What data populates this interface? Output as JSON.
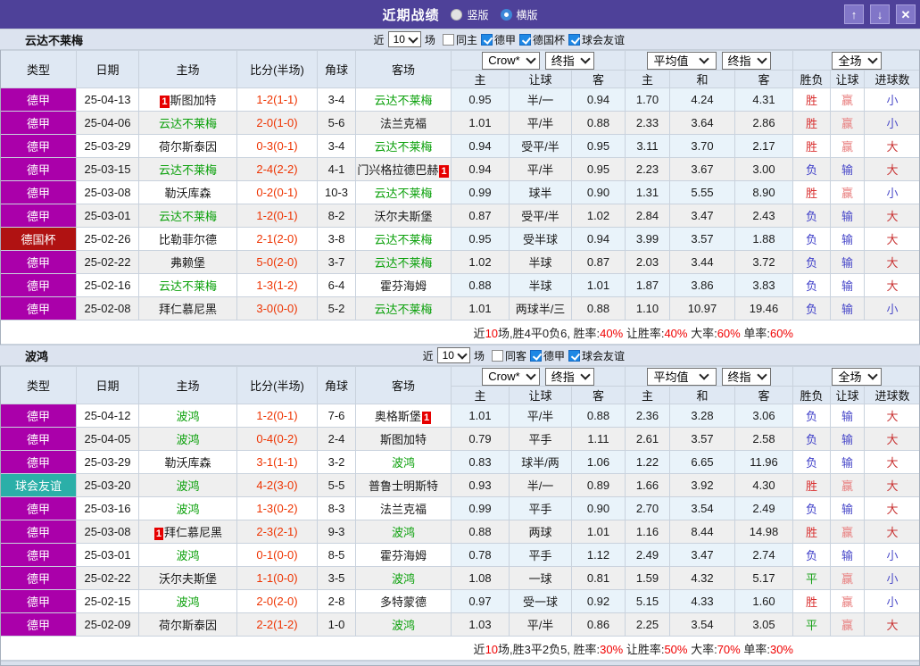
{
  "titlebar": {
    "title": "近期战绩",
    "radios": [
      {
        "label": "竖版",
        "selected": false
      },
      {
        "label": "横版",
        "selected": true
      }
    ],
    "buttons": {
      "up": "↑",
      "down": "↓",
      "close": "✕"
    }
  },
  "filters_common": {
    "near_label": "近",
    "near_value": "10",
    "games_label": "场"
  },
  "table_header": {
    "selects": {
      "crow": "Crow*",
      "crow_final": "终指",
      "avg": "平均值",
      "avg_final": "终指",
      "scope": "全场"
    },
    "columns": [
      "类型",
      "日期",
      "主场",
      "比分(半场)",
      "角球",
      "客场"
    ],
    "subcolumns": [
      "主",
      "让球",
      "客",
      "主",
      "和",
      "客",
      "胜负",
      "让球",
      "进球数"
    ]
  },
  "type_colors": {
    "德甲": "#aa00aa",
    "德国杯": "#b01212",
    "球会友谊": "#2bafa8"
  },
  "result_colors": {
    "胜": "#d93030",
    "负": "#3c3cc8",
    "平": "#18a018",
    "赢": "#e87d7d",
    "输": "#4646c8",
    "大": "#c83232",
    "小": "#4a4ac8"
  },
  "sections": [
    {
      "team": "云达不莱梅",
      "filters": [
        {
          "label": "同主",
          "checked": false
        },
        {
          "label": "德甲",
          "checked": true
        },
        {
          "label": "德国杯",
          "checked": true
        },
        {
          "label": "球会友谊",
          "checked": true
        }
      ],
      "rows": [
        {
          "type": "德甲",
          "date": "25-04-13",
          "home": "斯图加特",
          "home_badge": "1",
          "home_badge_pos": "before",
          "home_focus": false,
          "score": "1-2(1-1)",
          "corner": "3-4",
          "away": "云达不莱梅",
          "away_badge": "",
          "away_badge_pos": "",
          "away_focus": true,
          "odds": [
            "0.95",
            "半/一",
            "0.94",
            "1.70",
            "4.24",
            "4.31"
          ],
          "result": "胜",
          "handicap": "赢",
          "goals": "小"
        },
        {
          "type": "德甲",
          "date": "25-04-06",
          "home": "云达不莱梅",
          "home_badge": "",
          "home_badge_pos": "",
          "home_focus": true,
          "score": "2-0(1-0)",
          "corner": "5-6",
          "away": "法兰克福",
          "away_badge": "",
          "away_badge_pos": "",
          "away_focus": false,
          "odds": [
            "1.01",
            "平/半",
            "0.88",
            "2.33",
            "3.64",
            "2.86"
          ],
          "result": "胜",
          "handicap": "赢",
          "goals": "小"
        },
        {
          "type": "德甲",
          "date": "25-03-29",
          "home": "荷尔斯泰因",
          "home_badge": "",
          "home_badge_pos": "",
          "home_focus": false,
          "score": "0-3(0-1)",
          "corner": "3-4",
          "away": "云达不莱梅",
          "away_badge": "",
          "away_badge_pos": "",
          "away_focus": true,
          "odds": [
            "0.94",
            "受平/半",
            "0.95",
            "3.11",
            "3.70",
            "2.17"
          ],
          "result": "胜",
          "handicap": "赢",
          "goals": "大"
        },
        {
          "type": "德甲",
          "date": "25-03-15",
          "home": "云达不莱梅",
          "home_badge": "",
          "home_badge_pos": "",
          "home_focus": true,
          "score": "2-4(2-2)",
          "corner": "4-1",
          "away": "门兴格拉德巴赫",
          "away_badge": "1",
          "away_badge_pos": "after",
          "away_focus": false,
          "odds": [
            "0.94",
            "平/半",
            "0.95",
            "2.23",
            "3.67",
            "3.00"
          ],
          "result": "负",
          "handicap": "输",
          "goals": "大"
        },
        {
          "type": "德甲",
          "date": "25-03-08",
          "home": "勒沃库森",
          "home_badge": "",
          "home_badge_pos": "",
          "home_focus": false,
          "score": "0-2(0-1)",
          "corner": "10-3",
          "away": "云达不莱梅",
          "away_badge": "",
          "away_badge_pos": "",
          "away_focus": true,
          "odds": [
            "0.99",
            "球半",
            "0.90",
            "1.31",
            "5.55",
            "8.90"
          ],
          "result": "胜",
          "handicap": "赢",
          "goals": "小"
        },
        {
          "type": "德甲",
          "date": "25-03-01",
          "home": "云达不莱梅",
          "home_badge": "",
          "home_badge_pos": "",
          "home_focus": true,
          "score": "1-2(0-1)",
          "corner": "8-2",
          "away": "沃尔夫斯堡",
          "away_badge": "",
          "away_badge_pos": "",
          "away_focus": false,
          "odds": [
            "0.87",
            "受平/半",
            "1.02",
            "2.84",
            "3.47",
            "2.43"
          ],
          "result": "负",
          "handicap": "输",
          "goals": "大"
        },
        {
          "type": "德国杯",
          "date": "25-02-26",
          "home": "比勒菲尔德",
          "home_badge": "",
          "home_badge_pos": "",
          "home_focus": false,
          "score": "2-1(2-0)",
          "corner": "3-8",
          "away": "云达不莱梅",
          "away_badge": "",
          "away_badge_pos": "",
          "away_focus": true,
          "odds": [
            "0.95",
            "受半球",
            "0.94",
            "3.99",
            "3.57",
            "1.88"
          ],
          "result": "负",
          "handicap": "输",
          "goals": "大"
        },
        {
          "type": "德甲",
          "date": "25-02-22",
          "home": "弗赖堡",
          "home_badge": "",
          "home_badge_pos": "",
          "home_focus": false,
          "score": "5-0(2-0)",
          "corner": "3-7",
          "away": "云达不莱梅",
          "away_badge": "",
          "away_badge_pos": "",
          "away_focus": true,
          "odds": [
            "1.02",
            "半球",
            "0.87",
            "2.03",
            "3.44",
            "3.72"
          ],
          "result": "负",
          "handicap": "输",
          "goals": "大"
        },
        {
          "type": "德甲",
          "date": "25-02-16",
          "home": "云达不莱梅",
          "home_badge": "",
          "home_badge_pos": "",
          "home_focus": true,
          "score": "1-3(1-2)",
          "corner": "6-4",
          "away": "霍芬海姆",
          "away_badge": "",
          "away_badge_pos": "",
          "away_focus": false,
          "odds": [
            "0.88",
            "半球",
            "1.01",
            "1.87",
            "3.86",
            "3.83"
          ],
          "result": "负",
          "handicap": "输",
          "goals": "大"
        },
        {
          "type": "德甲",
          "date": "25-02-08",
          "home": "拜仁慕尼黑",
          "home_badge": "",
          "home_badge_pos": "",
          "home_focus": false,
          "score": "3-0(0-0)",
          "corner": "5-2",
          "away": "云达不莱梅",
          "away_badge": "",
          "away_badge_pos": "",
          "away_focus": true,
          "odds": [
            "1.01",
            "两球半/三",
            "0.88",
            "1.10",
            "10.97",
            "19.46"
          ],
          "result": "负",
          "handicap": "输",
          "goals": "小"
        }
      ],
      "summary": [
        [
          "近",
          0
        ],
        [
          "10",
          1
        ],
        [
          "场,胜4平0负6, 胜率:",
          0
        ],
        [
          "40%",
          1
        ],
        [
          " 让胜率:",
          0
        ],
        [
          "40%",
          1
        ],
        [
          " 大率:",
          0
        ],
        [
          "60%",
          1
        ],
        [
          " 单率:",
          0
        ],
        [
          "60%",
          1
        ]
      ]
    },
    {
      "team": "波鸿",
      "filters": [
        {
          "label": "同客",
          "checked": false
        },
        {
          "label": "德甲",
          "checked": true
        },
        {
          "label": "球会友谊",
          "checked": true
        }
      ],
      "rows": [
        {
          "type": "德甲",
          "date": "25-04-12",
          "home": "波鸿",
          "home_badge": "",
          "home_badge_pos": "",
          "home_focus": true,
          "score": "1-2(0-1)",
          "corner": "7-6",
          "away": "奥格斯堡",
          "away_badge": "1",
          "away_badge_pos": "after",
          "away_focus": false,
          "odds": [
            "1.01",
            "平/半",
            "0.88",
            "2.36",
            "3.28",
            "3.06"
          ],
          "result": "负",
          "handicap": "输",
          "goals": "大"
        },
        {
          "type": "德甲",
          "date": "25-04-05",
          "home": "波鸿",
          "home_badge": "",
          "home_badge_pos": "",
          "home_focus": true,
          "score": "0-4(0-2)",
          "corner": "2-4",
          "away": "斯图加特",
          "away_badge": "",
          "away_badge_pos": "",
          "away_focus": false,
          "odds": [
            "0.79",
            "平手",
            "1.11",
            "2.61",
            "3.57",
            "2.58"
          ],
          "result": "负",
          "handicap": "输",
          "goals": "大"
        },
        {
          "type": "德甲",
          "date": "25-03-29",
          "home": "勒沃库森",
          "home_badge": "",
          "home_badge_pos": "",
          "home_focus": false,
          "score": "3-1(1-1)",
          "corner": "3-2",
          "away": "波鸿",
          "away_badge": "",
          "away_badge_pos": "",
          "away_focus": true,
          "odds": [
            "0.83",
            "球半/两",
            "1.06",
            "1.22",
            "6.65",
            "11.96"
          ],
          "result": "负",
          "handicap": "输",
          "goals": "大"
        },
        {
          "type": "球会友谊",
          "date": "25-03-20",
          "home": "波鸿",
          "home_badge": "",
          "home_badge_pos": "",
          "home_focus": true,
          "score": "4-2(3-0)",
          "corner": "5-5",
          "away": "普鲁士明斯特",
          "away_badge": "",
          "away_badge_pos": "",
          "away_focus": false,
          "odds": [
            "0.93",
            "半/一",
            "0.89",
            "1.66",
            "3.92",
            "4.30"
          ],
          "result": "胜",
          "handicap": "赢",
          "goals": "大"
        },
        {
          "type": "德甲",
          "date": "25-03-16",
          "home": "波鸿",
          "home_badge": "",
          "home_badge_pos": "",
          "home_focus": true,
          "score": "1-3(0-2)",
          "corner": "8-3",
          "away": "法兰克福",
          "away_badge": "",
          "away_badge_pos": "",
          "away_focus": false,
          "odds": [
            "0.99",
            "平手",
            "0.90",
            "2.70",
            "3.54",
            "2.49"
          ],
          "result": "负",
          "handicap": "输",
          "goals": "大"
        },
        {
          "type": "德甲",
          "date": "25-03-08",
          "home": "拜仁慕尼黑",
          "home_badge": "1",
          "home_badge_pos": "before",
          "home_focus": false,
          "score": "2-3(2-1)",
          "corner": "9-3",
          "away": "波鸿",
          "away_badge": "",
          "away_badge_pos": "",
          "away_focus": true,
          "odds": [
            "0.88",
            "两球",
            "1.01",
            "1.16",
            "8.44",
            "14.98"
          ],
          "result": "胜",
          "handicap": "赢",
          "goals": "大"
        },
        {
          "type": "德甲",
          "date": "25-03-01",
          "home": "波鸿",
          "home_badge": "",
          "home_badge_pos": "",
          "home_focus": true,
          "score": "0-1(0-0)",
          "corner": "8-5",
          "away": "霍芬海姆",
          "away_badge": "",
          "away_badge_pos": "",
          "away_focus": false,
          "odds": [
            "0.78",
            "平手",
            "1.12",
            "2.49",
            "3.47",
            "2.74"
          ],
          "result": "负",
          "handicap": "输",
          "goals": "小"
        },
        {
          "type": "德甲",
          "date": "25-02-22",
          "home": "沃尔夫斯堡",
          "home_badge": "",
          "home_badge_pos": "",
          "home_focus": false,
          "score": "1-1(0-0)",
          "corner": "3-5",
          "away": "波鸿",
          "away_badge": "",
          "away_badge_pos": "",
          "away_focus": true,
          "odds": [
            "1.08",
            "一球",
            "0.81",
            "1.59",
            "4.32",
            "5.17"
          ],
          "result": "平",
          "handicap": "赢",
          "goals": "小"
        },
        {
          "type": "德甲",
          "date": "25-02-15",
          "home": "波鸿",
          "home_badge": "",
          "home_badge_pos": "",
          "home_focus": true,
          "score": "2-0(2-0)",
          "corner": "2-8",
          "away": "多特蒙德",
          "away_badge": "",
          "away_badge_pos": "",
          "away_focus": false,
          "odds": [
            "0.97",
            "受一球",
            "0.92",
            "5.15",
            "4.33",
            "1.60"
          ],
          "result": "胜",
          "handicap": "赢",
          "goals": "小"
        },
        {
          "type": "德甲",
          "date": "25-02-09",
          "home": "荷尔斯泰因",
          "home_badge": "",
          "home_badge_pos": "",
          "home_focus": false,
          "score": "2-2(1-2)",
          "corner": "1-0",
          "away": "波鸿",
          "away_badge": "",
          "away_badge_pos": "",
          "away_focus": true,
          "odds": [
            "1.03",
            "平/半",
            "0.86",
            "2.25",
            "3.54",
            "3.05"
          ],
          "result": "平",
          "handicap": "赢",
          "goals": "大"
        }
      ],
      "summary": [
        [
          "近",
          0
        ],
        [
          "10",
          1
        ],
        [
          "场,胜3平2负5, 胜率:",
          0
        ],
        [
          "30%",
          1
        ],
        [
          " 让胜率:",
          0
        ],
        [
          "50%",
          1
        ],
        [
          " 大率:",
          0
        ],
        [
          "70%",
          1
        ],
        [
          " 单率:",
          0
        ],
        [
          "30%",
          1
        ]
      ]
    }
  ]
}
